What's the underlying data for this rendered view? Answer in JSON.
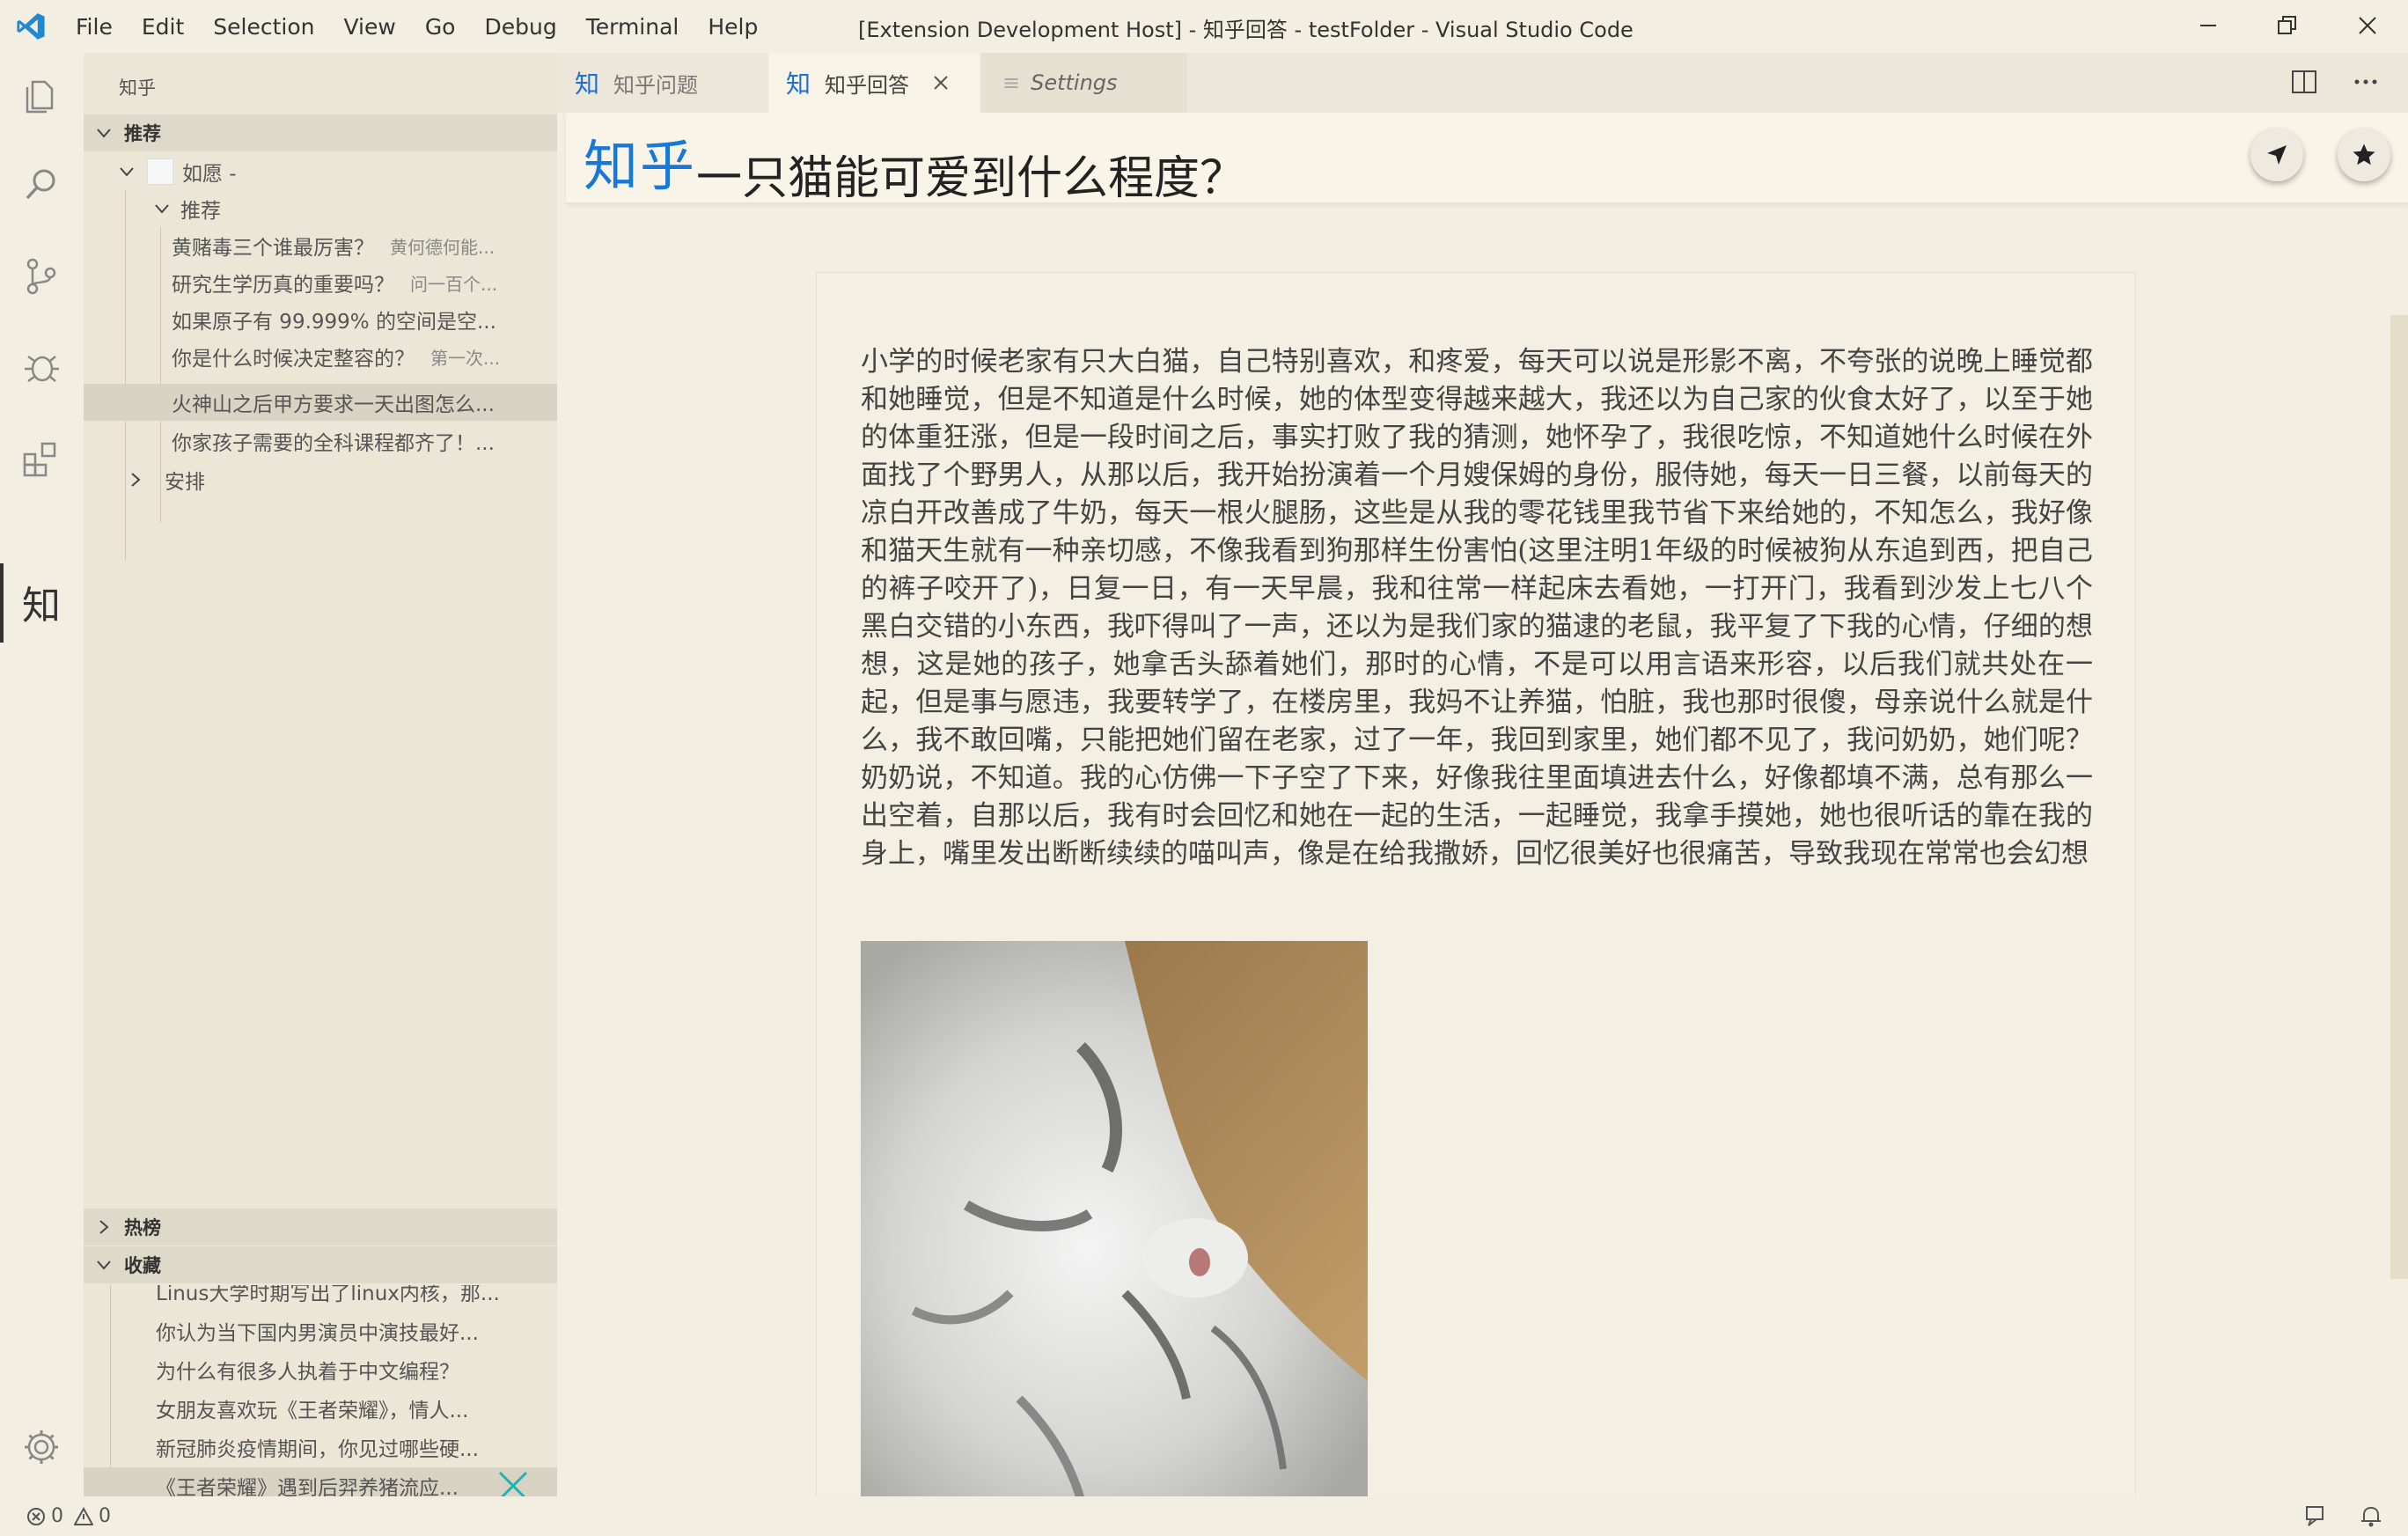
{
  "menu": [
    "File",
    "Edit",
    "Selection",
    "View",
    "Go",
    "Debug",
    "Terminal",
    "Help"
  ],
  "window_title": "[Extension Development Host] - 知乎回答 - testFolder - Visual Studio Code",
  "activity": {
    "zhihu_label": "知"
  },
  "sidebar": {
    "title": "知乎",
    "section_recommend": "推荐",
    "user": "如愿 -",
    "group_recommend": "推荐",
    "items": [
      {
        "title": "黄赌毒三个谁最厉害？",
        "sub": "黄何德何能..."
      },
      {
        "title": "研究生学历真的重要吗？",
        "sub": "问一百个..."
      },
      {
        "title": "如果原子有 99.999% 的空间是空...",
        "sub": ""
      },
      {
        "title": "你是什么时候决定整容的？",
        "sub": "第一次..."
      },
      {
        "title": "火神山之后甲方要求一天出图怎么...",
        "sub": ""
      },
      {
        "title": "你家孩子需要的全科课程都齐了！...",
        "sub": ""
      }
    ],
    "group_arrange": "安排",
    "section_hot": "热榜",
    "section_collect": "收藏",
    "collect_items": [
      "Linus大学时期写出了linux内核，那...",
      "你认为当下国内男演员中演技最好...",
      "为什么有很多人执着于中文编程？",
      "女朋友喜欢玩《王者荣耀》，情人...",
      "新冠肺炎疫情期间，你见过哪些硬...",
      "《王者荣耀》遇到后羿养猪流应..."
    ]
  },
  "tabs": [
    {
      "icon": "知",
      "label": "知乎问题"
    },
    {
      "icon": "知",
      "label": "知乎回答"
    },
    {
      "icon": "≡",
      "label": "Settings"
    }
  ],
  "editor": {
    "logo": "知乎",
    "question": "一只猫能可爱到什么程度？",
    "answer": "小学的时候老家有只大白猫，自己特别喜欢，和疼爱，每天可以说是形影不离，不夸张的说晚上睡觉都和她睡觉，但是不知道是什么时候，她的体型变得越来越大，我还以为自己家的伙食太好了，以至于她的体重狂涨，但是一段时间之后，事实打败了我的猜测，她怀孕了，我很吃惊，不知道她什么时候在外面找了个野男人，从那以后，我开始扮演着一个月嫂保姆的身份，服侍她，每天一日三餐，以前每天的凉白开改善成了牛奶，每天一根火腿肠，这些是从我的零花钱里我节省下来给她的，不知怎么，我好像和猫天生就有一种亲切感，不像我看到狗那样生份害怕(这里注明1年级的时候被狗从东追到西，把自己的裤子咬开了)，日复一日，有一天早晨，我和往常一样起床去看她，一打开门，我看到沙发上七八个黑白交错的小东西，我吓得叫了一声，还以为是我们家的猫逮的老鼠，我平复了下我的心情，仔细的想想，这是她的孩子，她拿舌头舔着她们，那时的心情，不是可以用言语来形容，以后我们就共处在一起，但是事与愿违，我要转学了，在楼房里，我妈不让养猫，怕脏，我也那时很傻，母亲说什么就是什么，我不敢回嘴，只能把她们留在老家，过了一年，我回到家里，她们都不见了，我问奶奶，她们呢？奶奶说，不知道。我的心仿佛一下子空了下来，好像我往里面填进去什么，好像都填不满，总有那么一出空着，自那以后，我有时会回忆和她在一起的生活，一起睡觉，我拿手摸她，她也很听话的靠在我的身上，嘴里发出断断续续的喵叫声，像是在给我撒娇，回忆很美好也很痛苦，导致我现在常常也会幻想"
  },
  "status": {
    "errors": "0",
    "warnings": "0"
  },
  "colors": {
    "background": "#f2eee1",
    "accent": "#1878d8",
    "sidebar": "#ebe6d6"
  }
}
